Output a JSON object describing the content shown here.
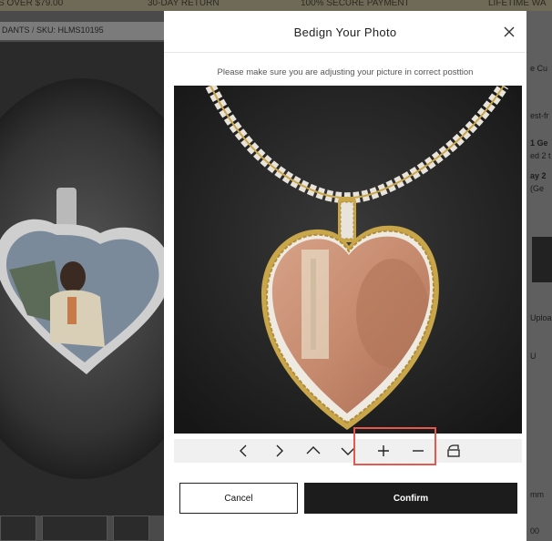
{
  "background": {
    "topbar": {
      "item1": "S OVER $79.00",
      "item2": "30-DAY RETURN",
      "item3": "100% SECURE PAYMENT",
      "item4": "LIFETIME WA"
    },
    "breadcrumb": "DANTS",
    "sku": "SKU: HLMS10195",
    "right_texts": [
      "e Cu",
      "est-fr",
      "1 Ge",
      "ed 2 t",
      "ay 2",
      "(Ge",
      "Uploa",
      "U",
      "mm",
      "00"
    ]
  },
  "modal": {
    "title": "Bedign Your Photo",
    "hint": "Please make sure you are adjusting your picture in correct posttion",
    "toolbar": {
      "icons": [
        "chevron-left-icon",
        "chevron-right-icon",
        "chevron-up-icon",
        "chevron-down-icon",
        "zoom-in-icon",
        "zoom-out-icon",
        "rotate-icon"
      ]
    },
    "cancel_label": "Cancel",
    "confirm_label": "Confirm"
  },
  "colors": {
    "highlight": "#e8574d",
    "gold": "#c9a64a",
    "confirm_bg": "#1c1c1c"
  }
}
